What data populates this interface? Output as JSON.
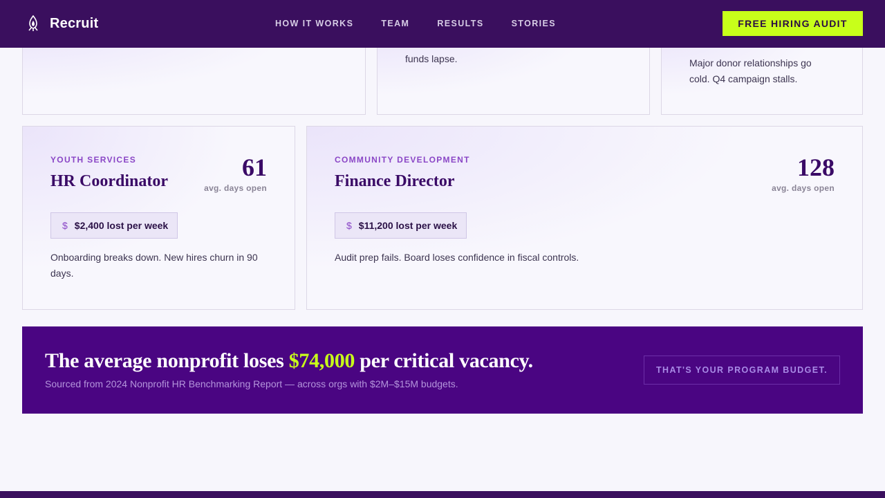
{
  "nav": {
    "brand": "Recruit",
    "brand_icon": "flame-logo-icon",
    "links": [
      "HOW IT WORKS",
      "TEAM",
      "RESULTS",
      "STORIES"
    ],
    "cta": "FREE HIRING AUDIT"
  },
  "top_cards": [
    {
      "text": ""
    },
    {
      "text": "funds lapse."
    },
    {
      "text_line_1": "Major donor relationships go",
      "text_line_2": "cold. Q4 campaign stalls."
    }
  ],
  "roles": [
    {
      "department": "YOUTH SERVICES",
      "title": "HR Coordinator",
      "days_open": "61",
      "days_label": "avg. days open",
      "loss": "$2,400 lost per week",
      "description_line_1": "Onboarding breaks down. New hires churn in 90",
      "description_line_2": "days."
    },
    {
      "department": "COMMUNITY DEVELOPMENT",
      "title": "Finance Director",
      "days_open": "128",
      "days_label": "avg. days open",
      "loss": "$11,200 lost per week",
      "description_line_1": "Audit prep fails. Board loses confidence in fiscal controls."
    }
  ],
  "banner": {
    "headline_before": "The average nonprofit loses ",
    "headline_amount": "$74,000",
    "headline_after": " per critical vacancy.",
    "source": "Sourced from 2024 Nonprofit HR Benchmarking Report — across orgs with $2M–$15M budgets.",
    "tag": "THAT'S YOUR PROGRAM BUDGET."
  },
  "colors": {
    "nav_bg": "#3a0f5e",
    "accent_lime": "#c8ff1a",
    "banner_bg": "#4a0582",
    "title_purple": "#3a0a66",
    "dept_purple": "#8a46c6"
  }
}
